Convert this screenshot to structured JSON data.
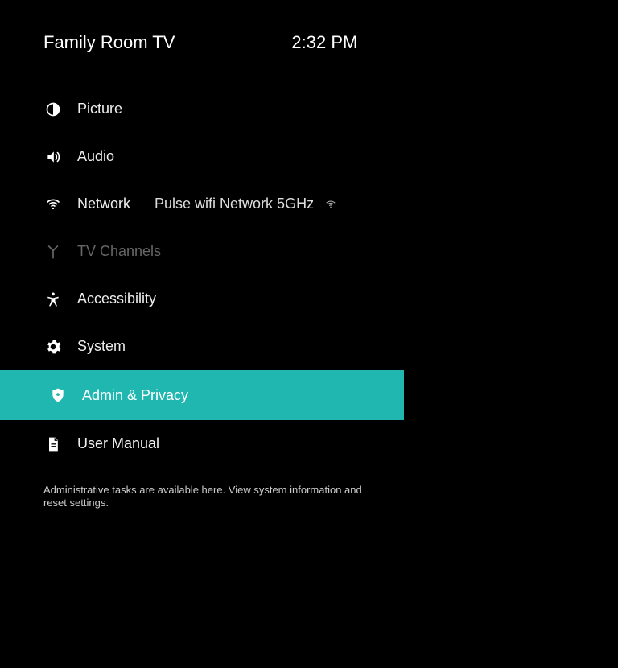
{
  "header": {
    "title": "Family Room TV",
    "time": "2:32 PM"
  },
  "menu": {
    "items": [
      {
        "label": "Picture",
        "value": "",
        "disabled": false,
        "selected": false
      },
      {
        "label": "Audio",
        "value": "",
        "disabled": false,
        "selected": false
      },
      {
        "label": "Network",
        "value": "Pulse wifi Network 5GHz",
        "disabled": false,
        "selected": false
      },
      {
        "label": "TV Channels",
        "value": "",
        "disabled": true,
        "selected": false
      },
      {
        "label": "Accessibility",
        "value": "",
        "disabled": false,
        "selected": false
      },
      {
        "label": "System",
        "value": "",
        "disabled": false,
        "selected": false
      },
      {
        "label": "Admin & Privacy",
        "value": "",
        "disabled": false,
        "selected": true
      },
      {
        "label": "User Manual",
        "value": "",
        "disabled": false,
        "selected": false
      }
    ]
  },
  "description": "Administrative tasks are available here. View system information and reset settings."
}
